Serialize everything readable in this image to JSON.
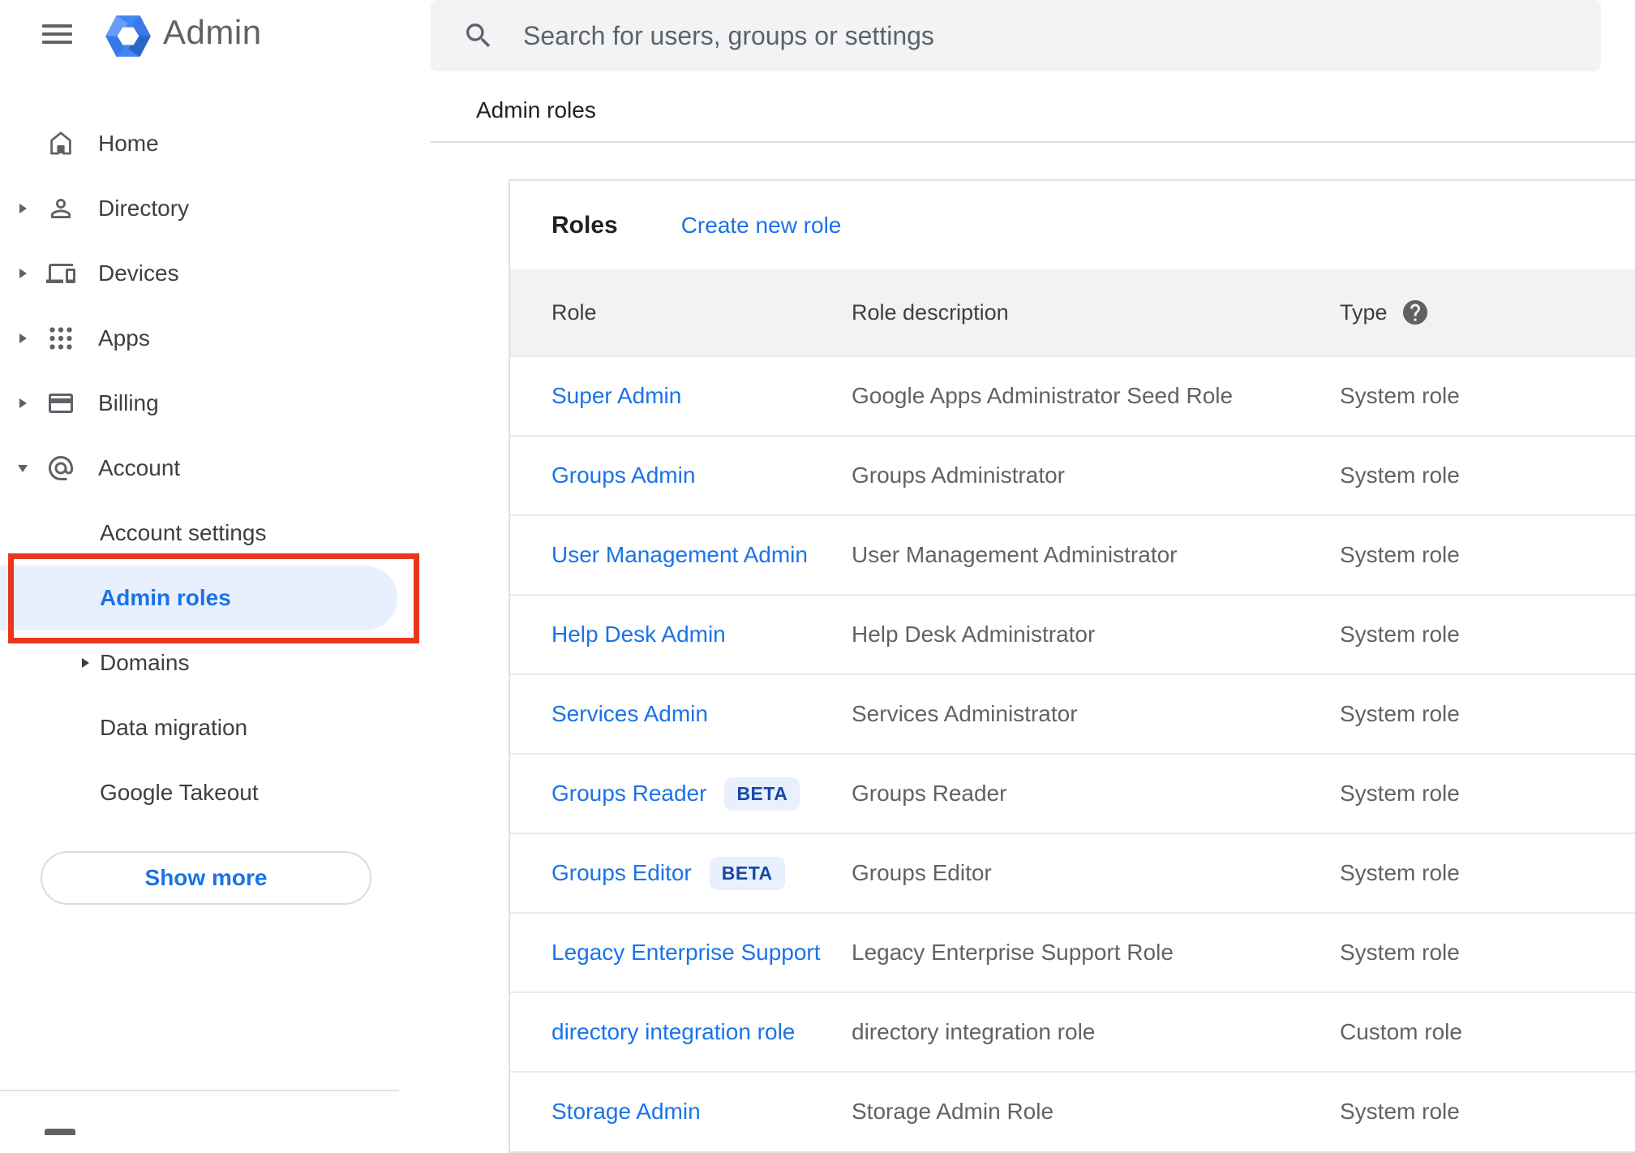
{
  "header": {
    "app_title": "Admin",
    "search_placeholder": "Search for users, groups or settings"
  },
  "breadcrumb": "Admin roles",
  "sidebar": {
    "items": [
      {
        "label": "Home"
      },
      {
        "label": "Directory"
      },
      {
        "label": "Devices"
      },
      {
        "label": "Apps"
      },
      {
        "label": "Billing"
      },
      {
        "label": "Account"
      }
    ],
    "account_subitems": [
      {
        "label": "Account settings"
      },
      {
        "label": "Admin roles",
        "active": true
      },
      {
        "label": "Domains",
        "expandable": true
      },
      {
        "label": "Data migration"
      },
      {
        "label": "Google Takeout"
      }
    ],
    "show_more_label": "Show more"
  },
  "main": {
    "panel_title": "Roles",
    "create_link": "Create new role",
    "beta_label": "BETA",
    "table": {
      "columns": [
        "Role",
        "Role description",
        "Type"
      ],
      "rows": [
        {
          "role": "Super Admin",
          "beta": false,
          "description": "Google Apps Administrator Seed Role",
          "type": "System role"
        },
        {
          "role": "Groups Admin",
          "beta": false,
          "description": "Groups Administrator",
          "type": "System role"
        },
        {
          "role": "User Management Admin",
          "beta": false,
          "description": "User Management Administrator",
          "type": "System role"
        },
        {
          "role": "Help Desk Admin",
          "beta": false,
          "description": "Help Desk Administrator",
          "type": "System role"
        },
        {
          "role": "Services Admin",
          "beta": false,
          "description": "Services Administrator",
          "type": "System role"
        },
        {
          "role": "Groups Reader",
          "beta": true,
          "description": "Groups Reader",
          "type": "System role"
        },
        {
          "role": "Groups Editor",
          "beta": true,
          "description": "Groups Editor",
          "type": "System role"
        },
        {
          "role": "Legacy Enterprise Support",
          "beta": false,
          "description": "Legacy Enterprise Support Role",
          "type": "System role"
        },
        {
          "role": "directory integration role",
          "beta": false,
          "description": "directory integration role",
          "type": "Custom role"
        },
        {
          "role": "Storage Admin",
          "beta": false,
          "description": "Storage Admin Role",
          "type": "System role"
        }
      ]
    }
  },
  "colors": {
    "link_blue": "#1a73e8",
    "active_highlight": "#e8f0fe",
    "annotation_red": "#e8371f",
    "table_header_bg": "#f2f2f2",
    "text_gray": "#5f6368",
    "logo_blue": "#4285f4"
  }
}
